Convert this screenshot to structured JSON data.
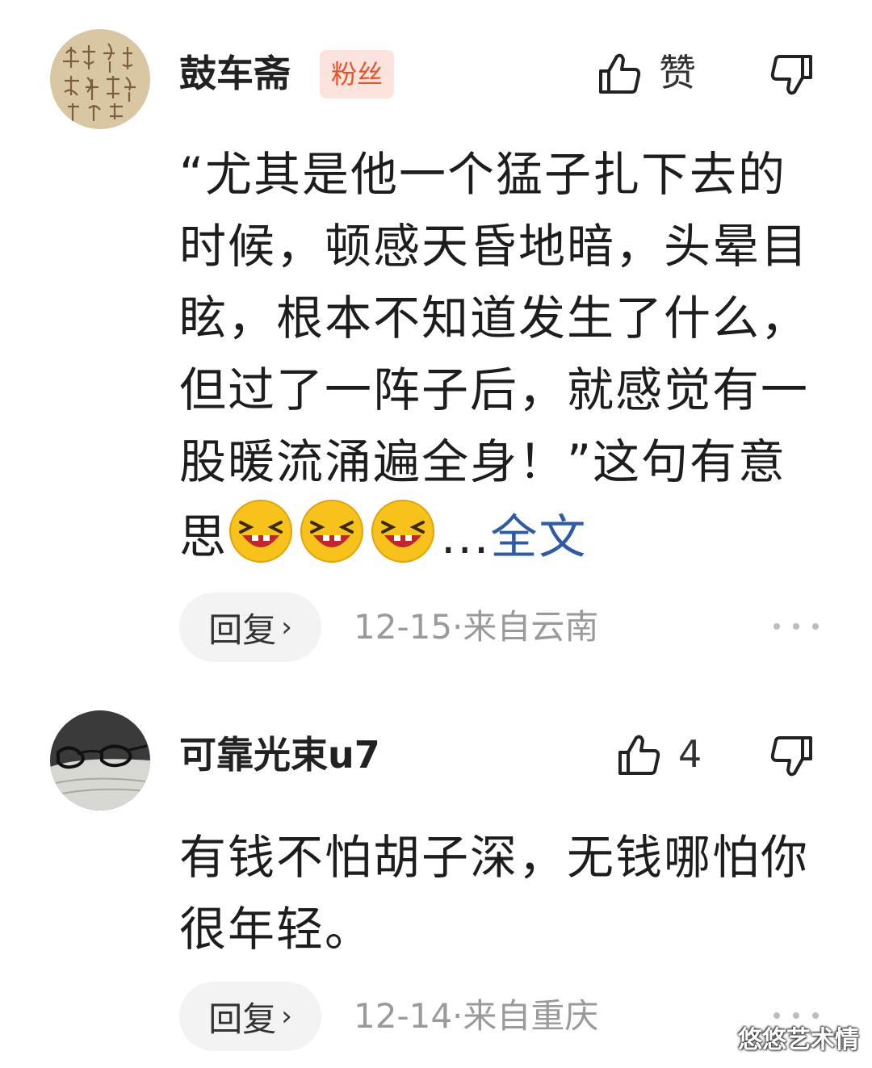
{
  "comments": [
    {
      "username": "鼓车斋",
      "badge": "粉丝",
      "like_label": "赞",
      "content_text": "“尤其是他一个猛子扎下去的时候，顿感天昏地暗，头晕目眩，根本不知道发生了什么，但过了一阵子后，就感觉有一股暖流涌遍全身！”这句有意思",
      "emojis": [
        "laughing-emoji",
        "laughing-emoji",
        "laughing-emoji"
      ],
      "ellipsis": "...",
      "fulltext_link": "全文",
      "reply_label": "回复",
      "reply_chevron": "›",
      "date": "12-15",
      "separator": "·",
      "location": "来自云南"
    },
    {
      "username": "可靠光束u7",
      "like_count": "4",
      "content_text": "有钱不怕胡子深，无钱哪怕你很年轻。",
      "reply_label": "回复",
      "reply_chevron": "›",
      "date": "12-14",
      "separator": "·",
      "location": "来自重庆"
    }
  ],
  "watermark": "悠悠艺术情",
  "colors": {
    "badge_bg": "#fde3dd",
    "badge_text": "#e8542a",
    "link": "#2e5aa6",
    "meta": "#9a9a9a",
    "reply_bg": "#f3f3f3"
  },
  "icons": {
    "like": "thumbs-up-icon",
    "dislike": "thumbs-down-icon",
    "more": "more-dots-icon"
  }
}
